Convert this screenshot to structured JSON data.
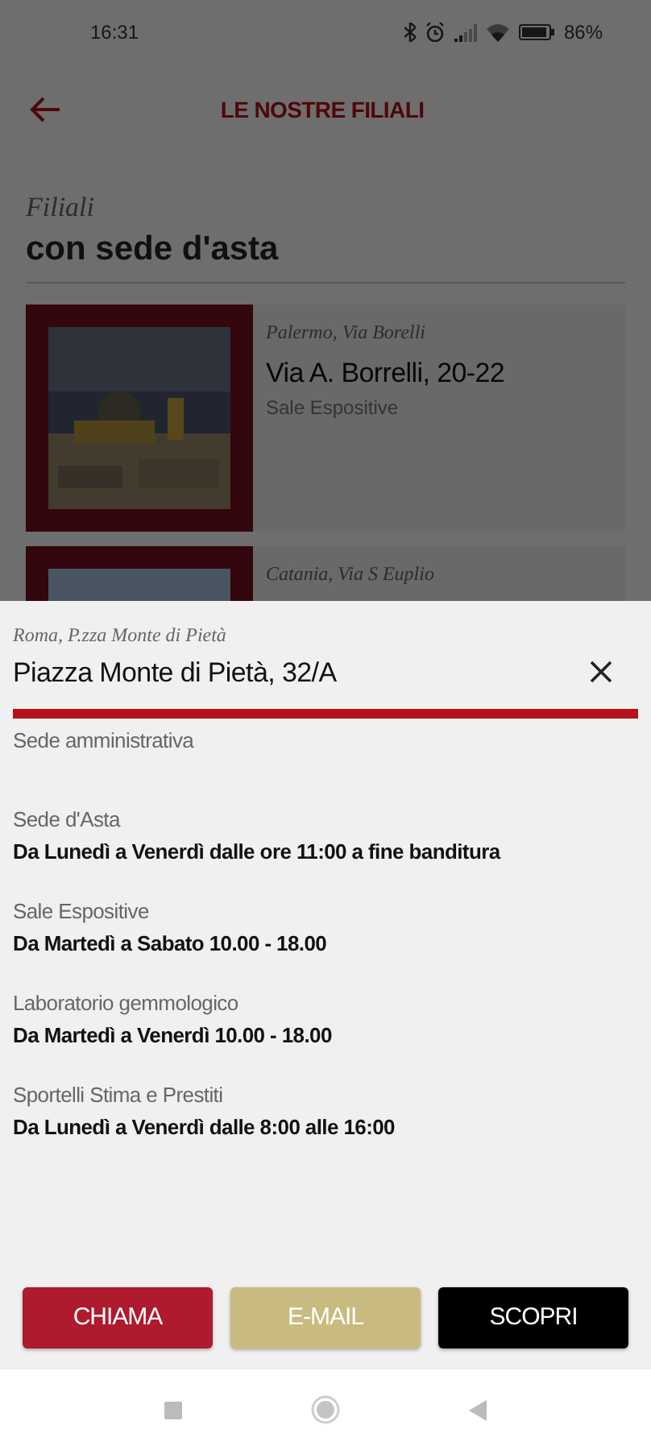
{
  "status_bar": {
    "time": "16:31",
    "battery": "86%"
  },
  "header": {
    "title": "LE NOSTRE FILIALI"
  },
  "section": {
    "kicker": "Filiali",
    "title": "con sede d'asta"
  },
  "branches": [
    {
      "city": "Palermo, Via Borelli",
      "address": "Via A. Borrelli, 20-22",
      "type": "Sale Espositive"
    },
    {
      "city": "Catania, Via S Euplio"
    }
  ],
  "sheet": {
    "city": "Roma, P.zza Monte di Pietà",
    "address": "Piazza Monte di Pietà, 32/A",
    "type": "Sede amministrativa",
    "hours": [
      {
        "label": "Sede d'Asta",
        "value": "Da Lunedì a Venerdì dalle ore 11:00 a fine banditura"
      },
      {
        "label": "Sale Espositive",
        "value": "Da Martedì a Sabato 10.00 - 18.00"
      },
      {
        "label": "Laboratorio gemmologico",
        "value": "Da Martedì a Venerdì 10.00 - 18.00"
      },
      {
        "label": "Sportelli Stima e Prestiti",
        "value": "Da Lunedì a Venerdì dalle 8:00 alle 16:00"
      }
    ],
    "buttons": [
      {
        "label": "CHIAMA",
        "color": "#ae1a2e"
      },
      {
        "label": "E-MAIL",
        "color": "#c9bb7f"
      },
      {
        "label": "SCOPRI",
        "color": "#000000"
      }
    ]
  }
}
